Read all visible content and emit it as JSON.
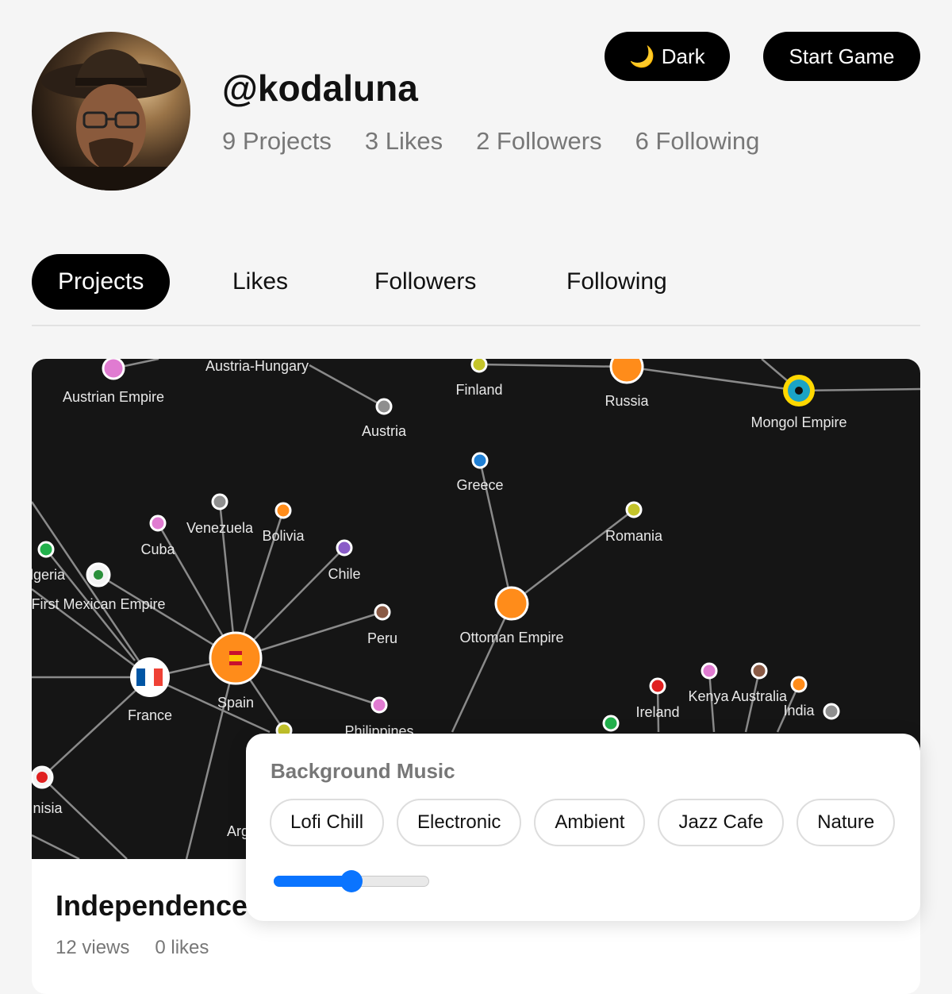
{
  "profile": {
    "username": "@kodaluna",
    "avatar_alt": "avatar",
    "stats": {
      "projects": "9 Projects",
      "likes": "3 Likes",
      "followers": "2 Followers",
      "following": "6 Following"
    }
  },
  "header": {
    "theme_icon": "🌙",
    "theme_label": "Dark",
    "start_label": "Start Game"
  },
  "tabs": [
    {
      "label": "Projects",
      "active": true
    },
    {
      "label": "Likes",
      "active": false
    },
    {
      "label": "Followers",
      "active": false
    },
    {
      "label": "Following",
      "active": false
    }
  ],
  "project": {
    "title": "Independence",
    "views": "12 views",
    "likes": "0 likes",
    "map_labels": [
      "Austrian Empire",
      "Austria-Hungary",
      "Austria",
      "Finland",
      "Russia",
      "Mongol Empire",
      "Greece",
      "Romania",
      "Venezuela",
      "Bolivia",
      "Cuba",
      "Chile",
      "lgeria",
      "First Mexican Empire",
      "Peru",
      "Ottoman Empire",
      "France",
      "Spain",
      "Philippines",
      "Ireland",
      "Kenya",
      "Australia",
      "India",
      "nisia",
      "Arg"
    ]
  },
  "music": {
    "title": "Background Music",
    "options": [
      "Lofi Chill",
      "Electronic",
      "Ambient",
      "Jazz Cafe",
      "Nature"
    ],
    "volume": 0.5
  },
  "colors": {
    "accent": "#0a74ff",
    "map_background": "#151515",
    "spain_node": "#ff8c1a",
    "highlight": "#ffd800"
  }
}
